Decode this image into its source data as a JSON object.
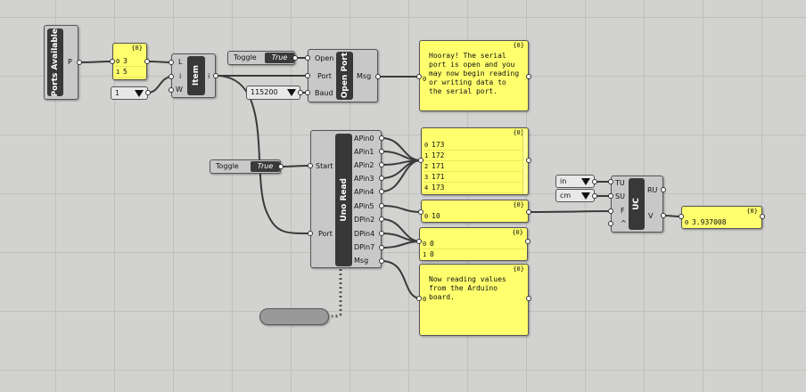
{
  "ports_available": {
    "title": "Ports Available",
    "output": "P"
  },
  "ports_panel": {
    "index_label": "{0}",
    "rows": [
      {
        "i": "0",
        "v": "3"
      },
      {
        "i": "1",
        "v": "5"
      }
    ]
  },
  "item_comp": {
    "title": "Item",
    "inputs": [
      "L",
      "i",
      "W"
    ],
    "output": "i"
  },
  "index_slider": {
    "value": "1"
  },
  "toggle_open": {
    "label": "Toggle",
    "value": "True"
  },
  "baud_dropdown": {
    "value": "115200"
  },
  "open_port": {
    "title": "Open Port",
    "inputs": [
      "Open",
      "Port",
      "Baud"
    ],
    "output": "Msg"
  },
  "msg_panel": {
    "index_label": "{0}",
    "row_index": "0",
    "text": "Hooray! The serial port is open and you may now begin reading or writing data to the serial port."
  },
  "toggle_start": {
    "label": "Toggle",
    "value": "True"
  },
  "uno_read": {
    "title": "Uno Read",
    "inputs": [
      "Start",
      "Port"
    ],
    "outputs": [
      "APin0",
      "APin1",
      "APin2",
      "APin3",
      "APin4",
      "APin5",
      "DPin2",
      "DPin4",
      "DPin7",
      "Msg"
    ]
  },
  "analog_panel": {
    "index_label": "{0}",
    "rows": [
      {
        "i": "0",
        "v": "173"
      },
      {
        "i": "1",
        "v": "172"
      },
      {
        "i": "2",
        "v": "171"
      },
      {
        "i": "3",
        "v": "171"
      },
      {
        "i": "4",
        "v": "173"
      }
    ]
  },
  "apin5_panel": {
    "index_label": "{0}",
    "rows": [
      {
        "i": "0",
        "v": "10"
      }
    ]
  },
  "dpin_panel": {
    "index_label": "{0}",
    "rows": [
      {
        "i": "0",
        "v": "0"
      },
      {
        "i": "1",
        "v": "0"
      }
    ]
  },
  "read_msg_panel": {
    "index_label": "{0}",
    "row_index": "0",
    "text": "Now reading values from the Arduino board."
  },
  "unit_in": {
    "value": "in"
  },
  "unit_cm": {
    "value": "cm"
  },
  "uc_comp": {
    "title": "UC",
    "inputs": [
      "TU",
      "SU",
      "F",
      "^"
    ],
    "outputs": [
      "RU",
      "V"
    ]
  },
  "result_panel": {
    "index_label": "{0}",
    "rows": [
      {
        "i": "0",
        "v": "3.937008"
      }
    ]
  }
}
